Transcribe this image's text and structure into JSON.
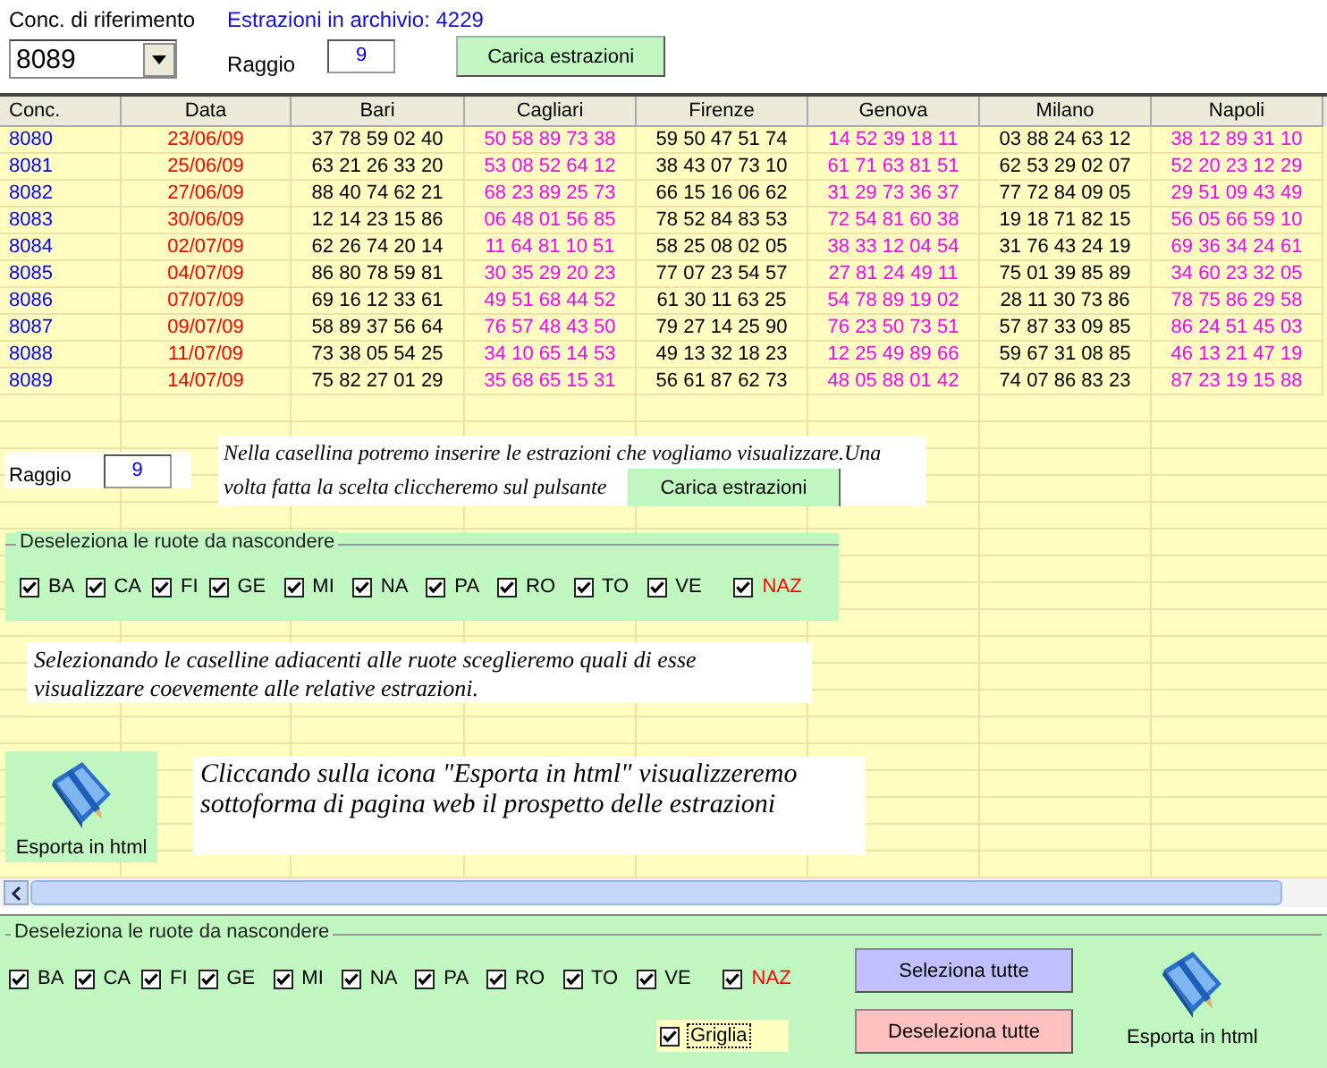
{
  "top": {
    "reference_label": "Conc. di riferimento",
    "archive_label": "Estrazioni in archivio: 4229",
    "reference_value": "8089",
    "radius_label": "Raggio",
    "radius_value": "9",
    "load_button": "Carica estrazioni"
  },
  "table": {
    "columns": [
      {
        "label": "Conc.",
        "color": "#0000ff"
      },
      {
        "label": "Data",
        "color": "#ff0000"
      },
      {
        "label": "Bari",
        "color": "#000000"
      },
      {
        "label": "Cagliari",
        "color": "#ff00ff"
      },
      {
        "label": "Firenze",
        "color": "#000000"
      },
      {
        "label": "Genova",
        "color": "#ff00ff"
      },
      {
        "label": "Milano",
        "color": "#000000"
      },
      {
        "label": "Napoli",
        "color": "#ff00ff"
      }
    ],
    "rows": [
      [
        "8080",
        "23/06/09",
        "37 78 59 02 40",
        "50 58 89 73 38",
        "59 50 47 51 74",
        "14 52 39 18 11",
        "03 88 24 63 12",
        "38 12 89 31 10"
      ],
      [
        "8081",
        "25/06/09",
        "63 21 26 33 20",
        "53 08 52 64 12",
        "38 43 07 73 10",
        "61 71 63 81 51",
        "62 53 29 02 07",
        "52 20 23 12 29"
      ],
      [
        "8082",
        "27/06/09",
        "88 40 74 62 21",
        "68 23 89 25 73",
        "66 15 16 06 62",
        "31 29 73 36 37",
        "77 72 84 09 05",
        "29 51 09 43 49"
      ],
      [
        "8083",
        "30/06/09",
        "12 14 23 15 86",
        "06 48 01 56 85",
        "78 52 84 83 53",
        "72 54 81 60 38",
        "19 18 71 82 15",
        "56 05 66 59 10"
      ],
      [
        "8084",
        "02/07/09",
        "62 26 74 20 14",
        "11 64 81 10 51",
        "58 25 08 02 05",
        "38 33 12 04 54",
        "31 76 43 24 19",
        "69 36 34 24 61"
      ],
      [
        "8085",
        "04/07/09",
        "86 80 78 59 81",
        "30 35 29 20 23",
        "77 07 23 54 57",
        "27 81 24 49 11",
        "75 01 39 85 89",
        "34 60 23 32 05"
      ],
      [
        "8086",
        "07/07/09",
        "69 16 12 33 61",
        "49 51 68 44 52",
        "61 30 11 63 25",
        "54 78 89 19 02",
        "28 11 30 73 86",
        "78 75 86 29 58"
      ],
      [
        "8087",
        "09/07/09",
        "58 89 37 56 64",
        "76 57 48 43 50",
        "79 27 14 25 90",
        "76 23 50 73 51",
        "57 87 33 09 85",
        "86 24 51 45 03"
      ],
      [
        "8088",
        "11/07/09",
        "73 38 05 54 25",
        "34 10 65 14 53",
        "49 13 32 18 23",
        "12 25 49 89 66",
        "59 67 31 08 85",
        "46 13 21 47 19"
      ],
      [
        "8089",
        "14/07/09",
        "75 82 27 01 29",
        "35 68 65 15 31",
        "56 61 87 62 73",
        "48 05 88 01 42",
        "74 07 86 83 23",
        "87 23 19 15 88"
      ]
    ]
  },
  "tutorial": {
    "radius_label": "Raggio",
    "radius_value": "9",
    "note_load_lines": [
      "Nella casellina potremo inserire le estrazioni che vogliamo visualizzare.Una",
      "volta fatta la scelta cliccheremo sul pulsante"
    ],
    "load_button": "Carica estrazioni",
    "wheels_title": "Deseleziona le ruote da nascondere",
    "wheels": [
      {
        "label": "BA",
        "checked": true,
        "color": "#000000"
      },
      {
        "label": "CA",
        "checked": true,
        "color": "#000000"
      },
      {
        "label": "FI",
        "checked": true,
        "color": "#000000"
      },
      {
        "label": "GE",
        "checked": true,
        "color": "#000000"
      },
      {
        "label": "MI",
        "checked": true,
        "color": "#000000"
      },
      {
        "label": "NA",
        "checked": true,
        "color": "#000000"
      },
      {
        "label": "PA",
        "checked": true,
        "color": "#000000"
      },
      {
        "label": "RO",
        "checked": true,
        "color": "#000000"
      },
      {
        "label": "TO",
        "checked": true,
        "color": "#000000"
      },
      {
        "label": "VE",
        "checked": true,
        "color": "#000000"
      },
      {
        "label": "NAZ",
        "checked": true,
        "color": "#ff0000"
      }
    ],
    "note_wheels": "Selezionando le caselline adiacenti alle ruote sceglieremo quali  di esse visualizzare coevemente alle relative estrazioni.",
    "export_label": "Esporta in html",
    "note_export": "Cliccando sulla icona \"Esporta in html\" visualizzeremo sottoforma di pagina web il prospetto delle estrazioni"
  },
  "bottom": {
    "wheels_title": "Deseleziona le ruote da nascondere",
    "wheels": [
      {
        "label": "BA",
        "checked": true,
        "color": "#000000"
      },
      {
        "label": "CA",
        "checked": true,
        "color": "#000000"
      },
      {
        "label": "FI",
        "checked": true,
        "color": "#000000"
      },
      {
        "label": "GE",
        "checked": true,
        "color": "#000000"
      },
      {
        "label": "MI",
        "checked": true,
        "color": "#000000"
      },
      {
        "label": "NA",
        "checked": true,
        "color": "#000000"
      },
      {
        "label": "PA",
        "checked": true,
        "color": "#000000"
      },
      {
        "label": "RO",
        "checked": true,
        "color": "#000000"
      },
      {
        "label": "TO",
        "checked": true,
        "color": "#000000"
      },
      {
        "label": "VE",
        "checked": true,
        "color": "#000000"
      },
      {
        "label": "NAZ",
        "checked": true,
        "color": "#ff0000"
      }
    ],
    "grid": {
      "label": "Griglia",
      "checked": true
    },
    "select_all": "Seleziona tutte",
    "deselect_all": "Deseleziona tutte",
    "export_label": "Esporta in html"
  }
}
